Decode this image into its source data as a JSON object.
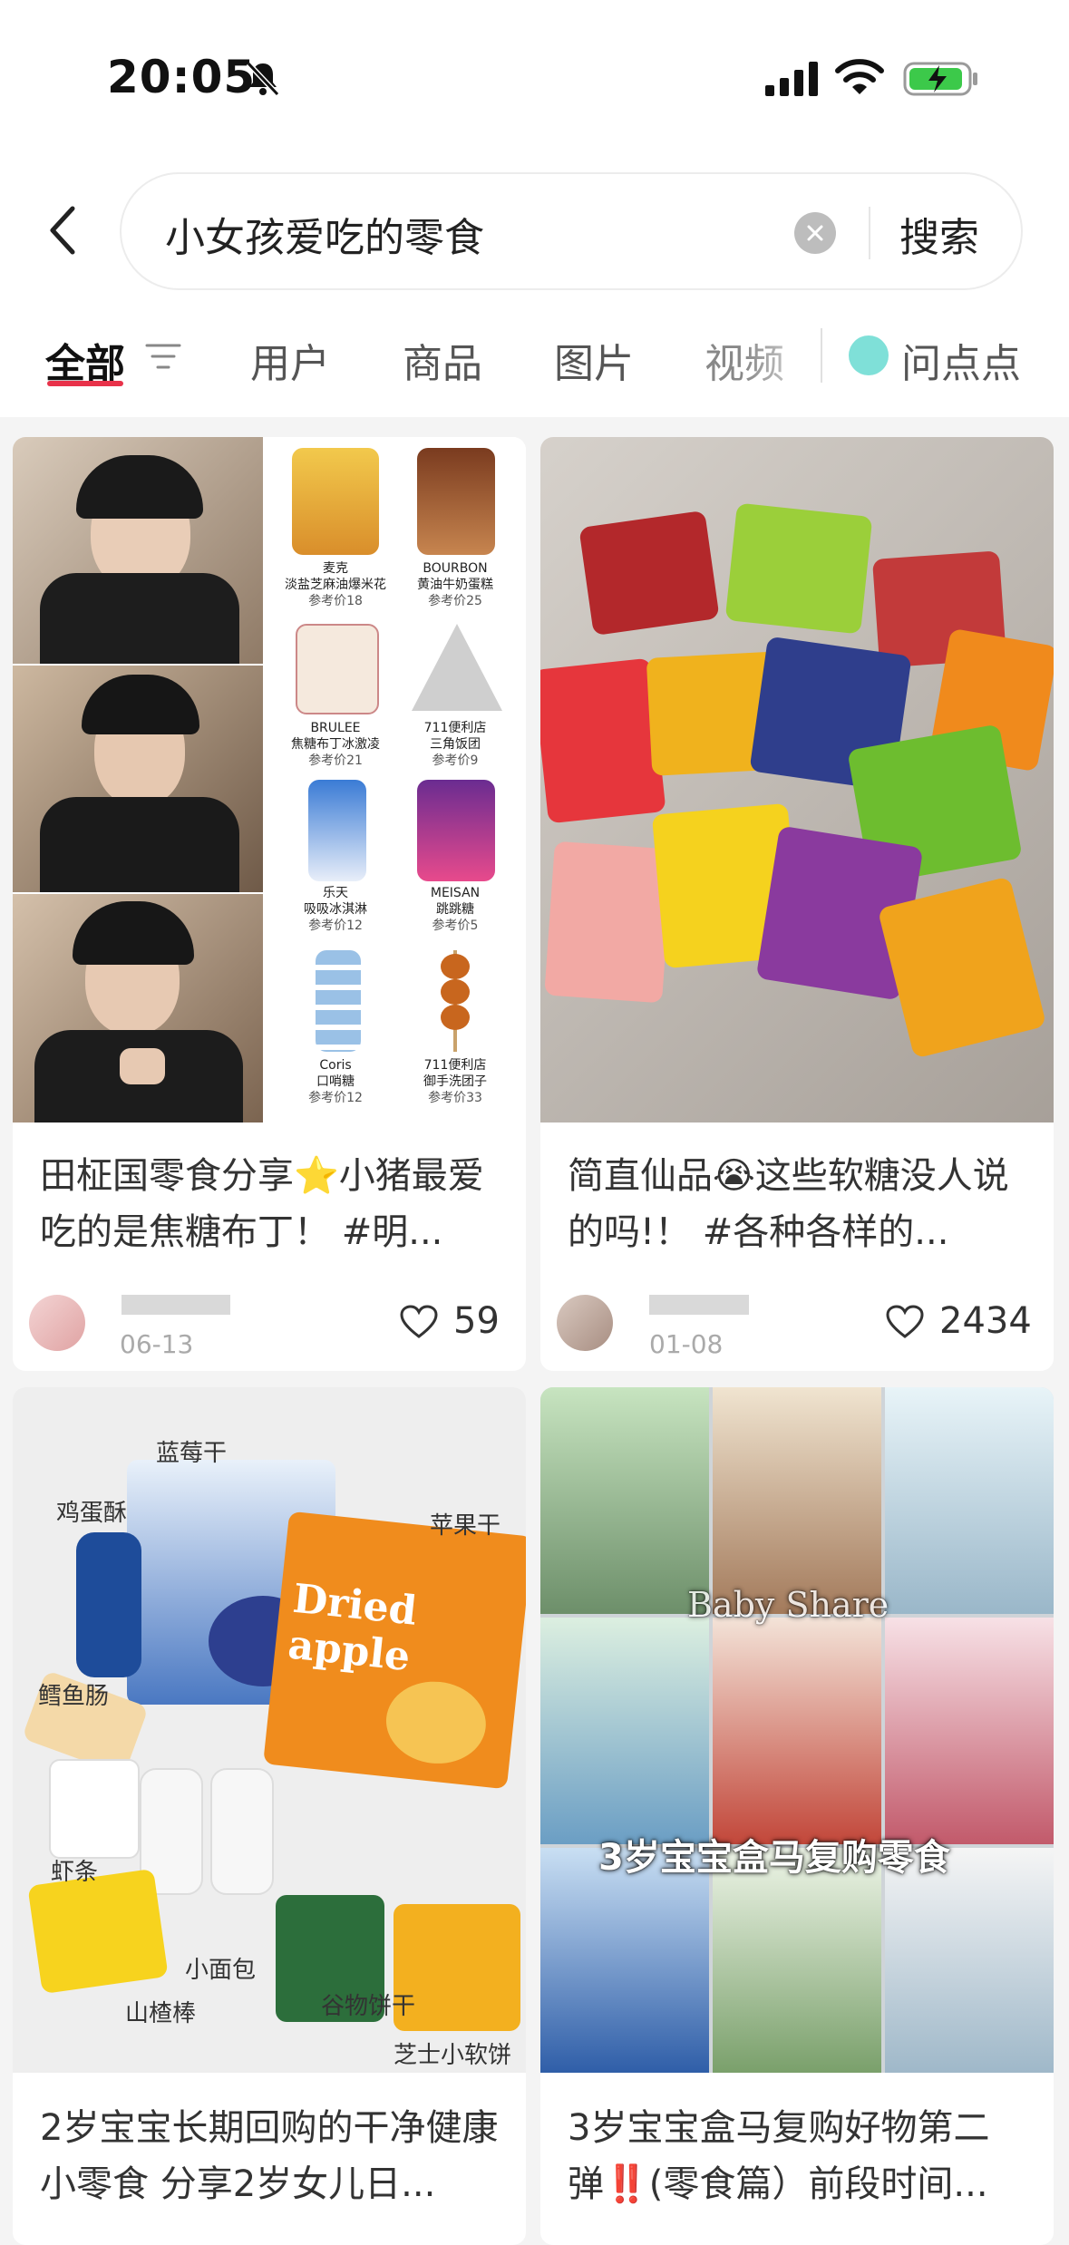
{
  "status": {
    "time": "20:05",
    "icons": [
      "bell-muted-icon",
      "cellular-signal-icon",
      "wifi-icon",
      "battery-charging-icon"
    ]
  },
  "search": {
    "query": "小女孩爱吃的零食",
    "button_label": "搜索"
  },
  "tabs": [
    {
      "label": "全部",
      "active": true
    },
    {
      "label": "用户"
    },
    {
      "label": "商品"
    },
    {
      "label": "图片"
    },
    {
      "label": "视频"
    },
    {
      "label": "问点点"
    }
  ],
  "colors": {
    "accent": "#e8324a",
    "ask_icon": "#7fe0d8"
  },
  "posts": [
    {
      "title": "田柾国零食分享⭐️小猪最爱吃的是焦糖布丁！ #明...",
      "date": "06-13",
      "likes": "59",
      "snacks": [
        {
          "brand": "麦克",
          "name": "淡盐芝麻油爆米花",
          "price": "参考价18"
        },
        {
          "brand": "BOURBON",
          "name": "黄油牛奶蛋糕",
          "price": "参考价25"
        },
        {
          "brand": "BRULEE",
          "name": "焦糖布丁冰激凌",
          "price": "参考价21"
        },
        {
          "brand": "711便利店",
          "name": "三角饭团",
          "price": "参考价9"
        },
        {
          "brand": "乐天",
          "name": "吸吸冰淇淋",
          "price": "参考价12"
        },
        {
          "brand": "MEISAN",
          "name": "跳跳糖",
          "price": "参考价5"
        },
        {
          "brand": "Coris",
          "name": "口哨糖",
          "price": "参考价12"
        },
        {
          "brand": "711便利店",
          "name": "御手洗团子",
          "price": "参考价33"
        }
      ]
    },
    {
      "title": "简直仙品😭这些软糖没人说的吗!！ #各种各样的...",
      "date": "01-08",
      "likes": "2434"
    },
    {
      "title": "2岁宝宝长期回购的干净健康小零食 分享2岁女儿日...",
      "image_labels": [
        "蓝莓干",
        "鸡蛋酥",
        "苹果干",
        "鳕鱼肠",
        "虾条",
        "小面包",
        "山楂棒",
        "谷物饼干",
        "芝士小软饼"
      ],
      "image_text": "Dried apple"
    },
    {
      "title": "3岁宝宝盒马复购好物第二弹‼️(零食篇）前段时间...",
      "image_overlay": "3岁宝宝盒马复购零食",
      "image_watermark": "Baby Share"
    }
  ]
}
